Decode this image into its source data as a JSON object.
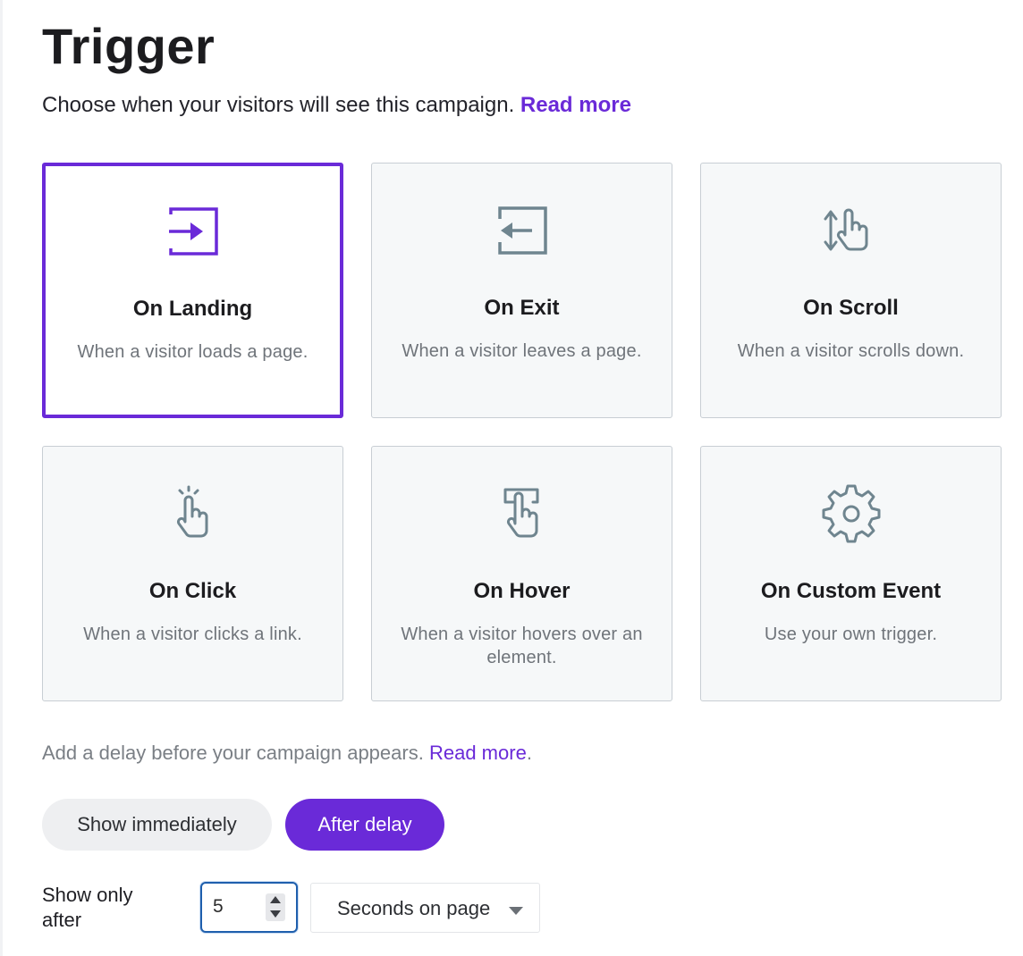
{
  "header": {
    "title": "Trigger",
    "subtitle": "Choose when your visitors will see this campaign.",
    "read_more": "Read more"
  },
  "triggers": [
    {
      "title": "On Landing",
      "description": "When a visitor loads a page.",
      "icon": "enter-arrow-icon",
      "selected": true
    },
    {
      "title": "On Exit",
      "description": "When a visitor leaves a page.",
      "icon": "exit-arrow-icon",
      "selected": false
    },
    {
      "title": "On Scroll",
      "description": "When a visitor scrolls down.",
      "icon": "scroll-hand-icon",
      "selected": false
    },
    {
      "title": "On Click",
      "description": "When a visitor clicks a link.",
      "icon": "click-hand-icon",
      "selected": false
    },
    {
      "title": "On Hover",
      "description": "When a visitor hovers over an element.",
      "icon": "hover-hand-icon",
      "selected": false
    },
    {
      "title": "On Custom Event",
      "description": "Use your own trigger.",
      "icon": "gear-icon",
      "selected": false
    }
  ],
  "delay": {
    "text": "Add a delay before your campaign appears.",
    "read_more": "Read more",
    "period": ".",
    "options": [
      "Show immediately",
      "After delay"
    ],
    "selected_option": "After delay",
    "show_label": "Show only after",
    "amount": "5",
    "unit": "Seconds on page"
  },
  "colors": {
    "accent": "#6a2ad8",
    "icon_gray": "#6f858f",
    "focus_blue": "#1f5fad"
  }
}
